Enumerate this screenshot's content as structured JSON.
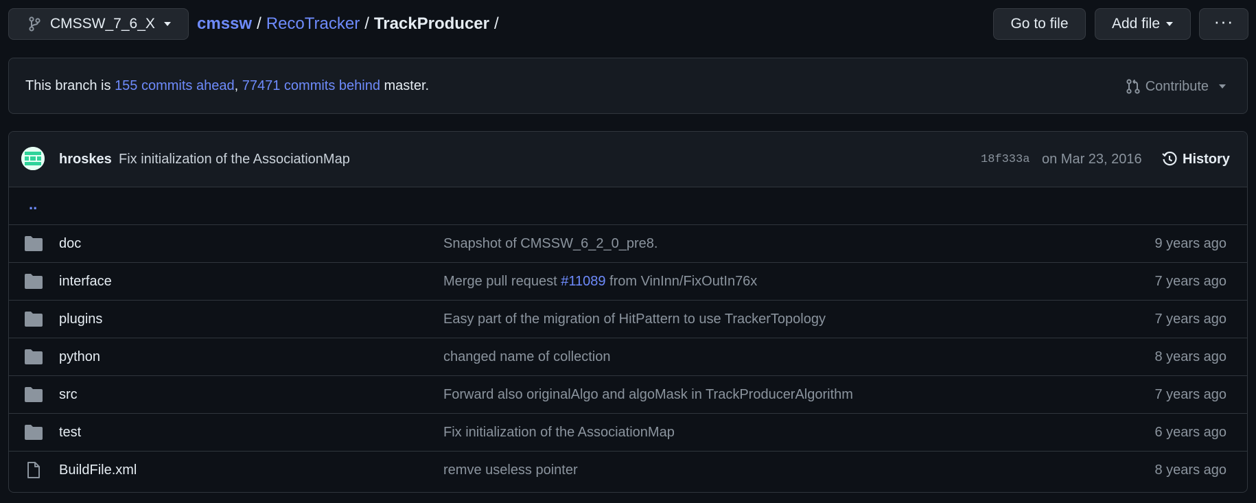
{
  "header": {
    "branch_name": "CMSSW_7_6_X",
    "breadcrumb": {
      "root": "cmssw",
      "sep": "/",
      "middle": "RecoTracker",
      "current": "TrackProducer"
    },
    "goto_label": "Go to file",
    "add_file_label": "Add file",
    "more_label": "···"
  },
  "branch_status": {
    "prefix": "This branch is ",
    "ahead": "155 commits ahead",
    "comma": ", ",
    "behind": "77471 commits behind",
    "suffix": " master.",
    "contribute_label": "Contribute"
  },
  "latest_commit": {
    "author": "hroskes",
    "message": "Fix initialization of the AssociationMap",
    "sha": "18f333a",
    "date": "on Mar 23, 2016",
    "history_label": "History"
  },
  "parent_dir": "..",
  "files": [
    {
      "type": "folder",
      "name": "doc",
      "message": "Snapshot of CMSSW_6_2_0_pre8.",
      "age": "9 years ago"
    },
    {
      "type": "folder",
      "name": "interface",
      "message_pre": "Merge pull request ",
      "message_pr": "#11089",
      "message_post": " from VinInn/FixOutIn76x",
      "age": "7 years ago"
    },
    {
      "type": "folder",
      "name": "plugins",
      "message": "Easy part of the migration of HitPattern to use TrackerTopology",
      "age": "7 years ago"
    },
    {
      "type": "folder",
      "name": "python",
      "message": "changed name of collection",
      "age": "8 years ago"
    },
    {
      "type": "folder",
      "name": "src",
      "message": "Forward also originalAlgo and algoMask in TrackProducerAlgorithm",
      "age": "7 years ago"
    },
    {
      "type": "folder",
      "name": "test",
      "message": "Fix initialization of the AssociationMap",
      "age": "6 years ago"
    },
    {
      "type": "file",
      "name": "BuildFile.xml",
      "message": "remve useless pointer",
      "age": "8 years ago"
    }
  ],
  "colors": {
    "background": "#0d1117",
    "panel": "#161b22",
    "link": "#6e8bfc",
    "muted": "#8b949e",
    "avatar_accent": "#2fd39a"
  }
}
